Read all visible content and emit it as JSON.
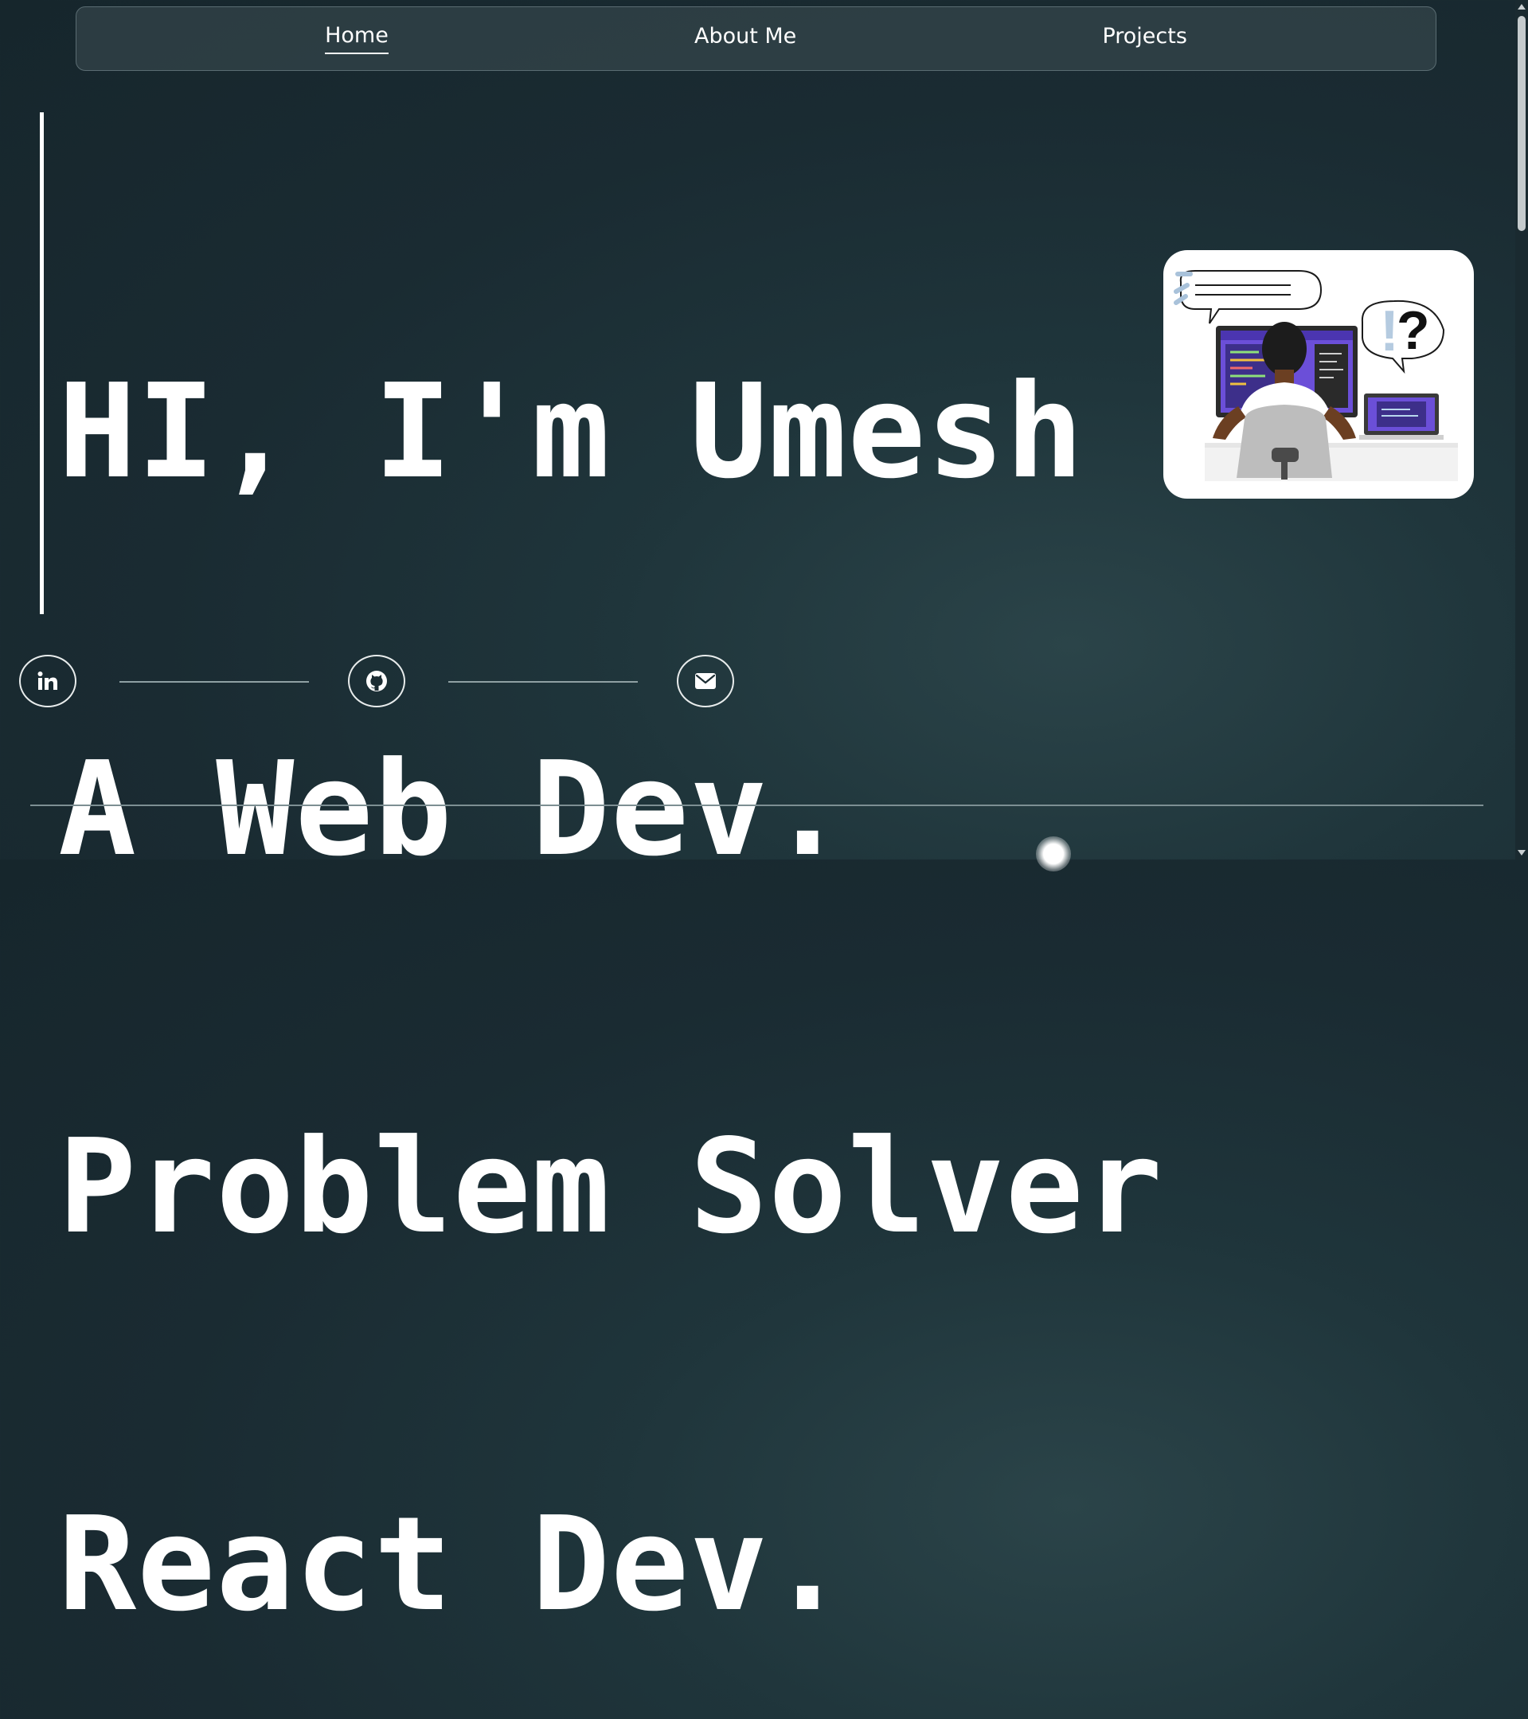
{
  "nav": {
    "items": [
      {
        "label": "Home",
        "active": true
      },
      {
        "label": "About Me",
        "active": false
      },
      {
        "label": "Projects",
        "active": false
      }
    ]
  },
  "hero": {
    "lines": [
      "HI, I'm Umesh",
      "A Web Dev.",
      "Problem Solver",
      "React Dev."
    ]
  },
  "illustration": {
    "icon": "developer-at-desk-illustration"
  },
  "social": {
    "links": [
      {
        "name": "linkedin",
        "icon": "linkedin-icon",
        "glyph": "in"
      },
      {
        "name": "github",
        "icon": "github-icon"
      },
      {
        "name": "email",
        "icon": "mail-icon"
      }
    ]
  },
  "colors": {
    "background": "#1a2b32",
    "text": "#ffffff",
    "accent_purple": "#6b4fd8"
  }
}
